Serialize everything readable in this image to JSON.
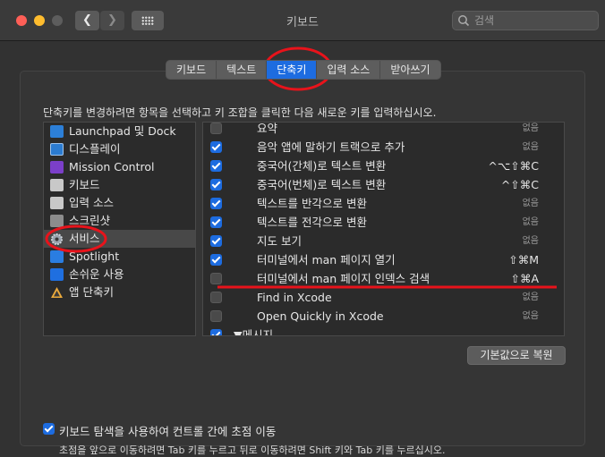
{
  "window": {
    "title": "키보드"
  },
  "search": {
    "placeholder": "검색"
  },
  "tabs": [
    {
      "label": "키보드"
    },
    {
      "label": "텍스트"
    },
    {
      "label": "단축키",
      "active": true
    },
    {
      "label": "입력 소스"
    },
    {
      "label": "받아쓰기"
    }
  ],
  "instruction": "단축키를 변경하려면 항목을 선택하고 키 조합을 클릭한 다음 새로운 키를 입력하십시오.",
  "categories": [
    {
      "label": "Launchpad 및 Dock",
      "icon": "launchpad-dock-icon"
    },
    {
      "label": "디스플레이",
      "icon": "display-icon"
    },
    {
      "label": "Mission Control",
      "icon": "mission-control-icon"
    },
    {
      "label": "키보드",
      "icon": "keyboard-icon"
    },
    {
      "label": "입력 소스",
      "icon": "input-source-icon"
    },
    {
      "label": "스크린샷",
      "icon": "screenshot-icon"
    },
    {
      "label": "서비스",
      "icon": "gear-icon",
      "selected": true
    },
    {
      "label": "Spotlight",
      "icon": "spotlight-icon"
    },
    {
      "label": "손쉬운 사용",
      "icon": "accessibility-icon"
    },
    {
      "label": "앱 단축키",
      "icon": "app-shortcuts-icon"
    }
  ],
  "services": [
    {
      "checked": false,
      "label": "요약",
      "shortcut": "없음"
    },
    {
      "checked": true,
      "label": "음악 앱에 말하기 트랙으로 추가",
      "shortcut": "없음"
    },
    {
      "checked": true,
      "label": "중국어(간체)로 텍스트 변환",
      "shortcut": "^⌥⇧⌘C"
    },
    {
      "checked": true,
      "label": "중국어(번체)로 텍스트 변환",
      "shortcut": "^⇧⌘C"
    },
    {
      "checked": true,
      "label": "텍스트를 반각으로 변환",
      "shortcut": "없음"
    },
    {
      "checked": true,
      "label": "텍스트를 전각으로 변환",
      "shortcut": "없음"
    },
    {
      "checked": true,
      "label": "지도 보기",
      "shortcut": "없음"
    },
    {
      "checked": true,
      "label": "터미널에서 man 페이지 열기",
      "shortcut": "⇧⌘M"
    },
    {
      "checked": false,
      "label": "터미널에서 man 페이지 인덱스 검색",
      "shortcut": "⇧⌘A"
    },
    {
      "checked": false,
      "label": "Find in Xcode",
      "shortcut": "없음"
    },
    {
      "checked": false,
      "label": "Open Quickly in Xcode",
      "shortcut": "없음"
    },
    {
      "checked": true,
      "label": "▼메시지",
      "shortcut": ""
    }
  ],
  "restore_button": "기본값으로 복원",
  "keyboard_nav": {
    "checked": true,
    "label": "키보드 탐색을 사용하여 컨트롤 간에 초점 이동",
    "hint": "초점을 앞으로 이동하려면 Tab 키를 누르고 뒤로 이동하려면 Shift 키와 Tab 키를 누르십시오."
  },
  "colors": {
    "accent": "#1d6ce0",
    "annotation": "#e8131b"
  }
}
